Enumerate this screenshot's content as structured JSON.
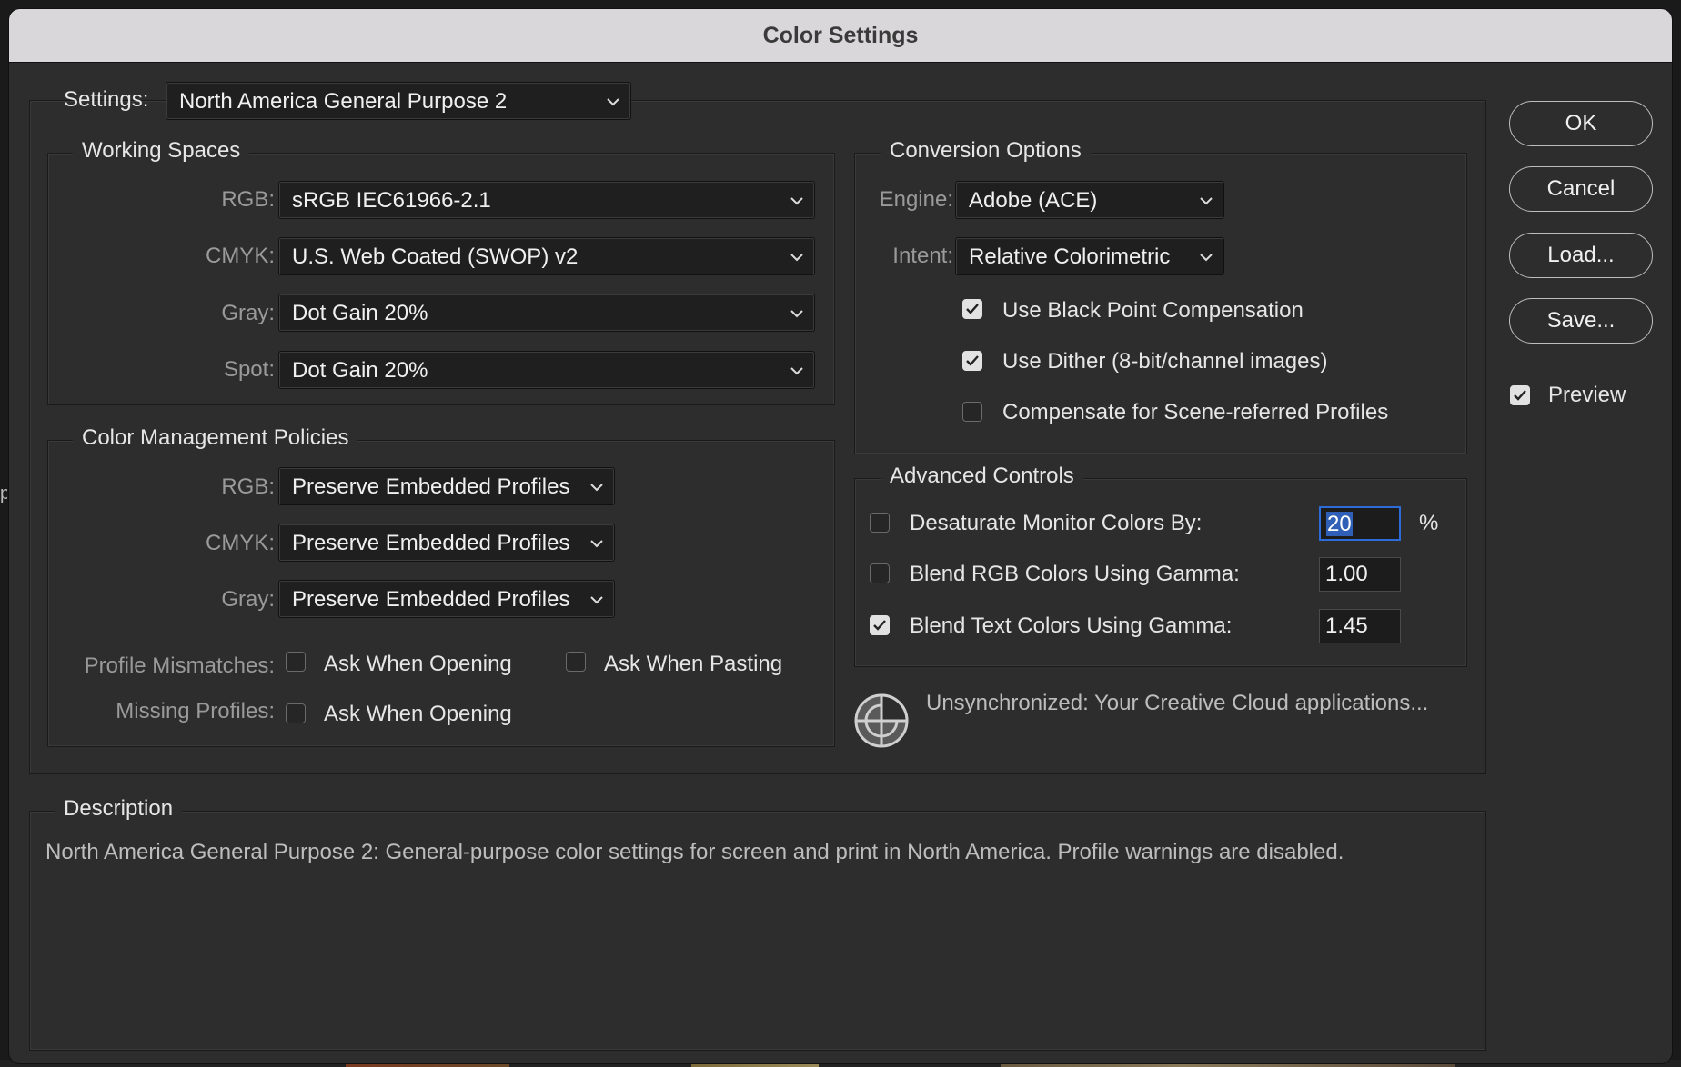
{
  "window": {
    "title": "Color Settings"
  },
  "settings": {
    "label": "Settings:",
    "value": "North America General Purpose 2"
  },
  "working_spaces": {
    "title": "Working Spaces",
    "rgb_label": "RGB:",
    "rgb_value": "sRGB IEC61966-2.1",
    "cmyk_label": "CMYK:",
    "cmyk_value": "U.S. Web Coated (SWOP) v2",
    "gray_label": "Gray:",
    "gray_value": "Dot Gain 20%",
    "spot_label": "Spot:",
    "spot_value": "Dot Gain 20%"
  },
  "policies": {
    "title": "Color Management Policies",
    "rgb_label": "RGB:",
    "rgb_value": "Preserve Embedded Profiles",
    "cmyk_label": "CMYK:",
    "cmyk_value": "Preserve Embedded Profiles",
    "gray_label": "Gray:",
    "gray_value": "Preserve Embedded Profiles",
    "mismatch_label": "Profile Mismatches:",
    "mismatch_opening": {
      "label": "Ask When Opening",
      "checked": false
    },
    "mismatch_pasting": {
      "label": "Ask When Pasting",
      "checked": false
    },
    "missing_label": "Missing Profiles:",
    "missing_opening": {
      "label": "Ask When Opening",
      "checked": false
    }
  },
  "conversion": {
    "title": "Conversion Options",
    "engine_label": "Engine:",
    "engine_value": "Adobe (ACE)",
    "intent_label": "Intent:",
    "intent_value": "Relative Colorimetric",
    "black_point": {
      "label": "Use Black Point Compensation",
      "checked": true
    },
    "dither": {
      "label": "Use Dither (8-bit/channel images)",
      "checked": true
    },
    "scene": {
      "label": "Compensate for Scene-referred Profiles",
      "checked": false
    }
  },
  "advanced": {
    "title": "Advanced Controls",
    "desaturate": {
      "label": "Desaturate Monitor Colors By:",
      "checked": false,
      "value": "20",
      "unit": "%"
    },
    "blend_rgb": {
      "label": "Blend RGB Colors Using Gamma:",
      "checked": false,
      "value": "1.00"
    },
    "blend_text": {
      "label": "Blend Text Colors Using Gamma:",
      "checked": true,
      "value": "1.45"
    }
  },
  "sync": {
    "text": "Unsynchronized: Your Creative Cloud applications...",
    "icon": "sync-target-icon"
  },
  "description": {
    "title": "Description",
    "text": "North America General Purpose 2:  General-purpose color settings for screen and print in North America. Profile warnings are disabled."
  },
  "buttons": {
    "ok": "OK",
    "cancel": "Cancel",
    "load": "Load...",
    "save": "Save..."
  },
  "preview": {
    "label": "Preview",
    "checked": true
  },
  "colors": {
    "accent": "#2d6bd8",
    "dialog_bg": "#2d2d2d",
    "titlebar_bg": "#dad7da"
  }
}
